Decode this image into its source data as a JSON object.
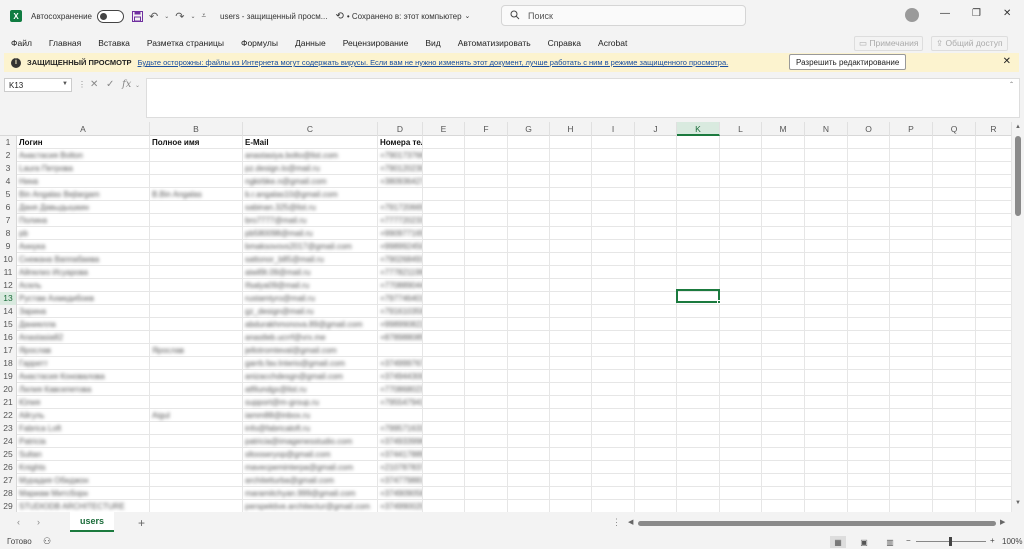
{
  "app": {
    "autosave_label": "Автосохранение",
    "doc_title": "users  -  защищенный просм...",
    "saved_status": "• Сохранено в: этот компьютер",
    "search_placeholder": "Поиск"
  },
  "ribbon": {
    "tabs": [
      "Файл",
      "Главная",
      "Вставка",
      "Разметка страницы",
      "Формулы",
      "Данные",
      "Рецензирование",
      "Вид",
      "Автоматизировать",
      "Справка",
      "Acrobat"
    ],
    "comments": "Примечания",
    "share": "Общий доступ"
  },
  "protected_view": {
    "title": "ЗАЩИЩЕННЫЙ ПРОСМОТР",
    "message": "Будьте осторожны: файлы из Интернета могут содержать вирусы. Если вам не нужно изменять этот документ, лучше работать с ним в режиме защищенного просмотра.",
    "enable_button": "Разрешить редактирование"
  },
  "formula_bar": {
    "name_box": "K13",
    "formula": ""
  },
  "grid": {
    "columns": [
      "A",
      "B",
      "C",
      "D",
      "E",
      "F",
      "G",
      "H",
      "I",
      "J",
      "K",
      "L",
      "M",
      "N",
      "O",
      "P",
      "Q",
      "R"
    ],
    "active_column": "K",
    "active_row": "13",
    "header_row": {
      "row": "1",
      "a": "Логин",
      "b": "Полное имя",
      "c": "E-Mail",
      "d": "Номера телефонов"
    },
    "rows": [
      {
        "num": "2",
        "a": "Анастасия Bolton",
        "b": "",
        "c": "anastasiya.bolto@list.com",
        "d": "+79017376655"
      },
      {
        "num": "3",
        "a": "Laura Петрова",
        "b": "",
        "c": "pz.design.lo@mail.ru",
        "d": "+79012023039"
      },
      {
        "num": "4",
        "a": "Нина",
        "b": "",
        "c": "ngkirbke.n@gmail.com",
        "d": "+380936427473"
      },
      {
        "num": "5",
        "a": "Bin Angalas Bejlargam",
        "b": "B.Bin Angalas",
        "c": "b.r.angalas10@gmail.com",
        "d": ""
      },
      {
        "num": "6",
        "a": "Даня Давыдышкин",
        "b": "",
        "c": "sabinan.325@list.ru",
        "d": "+79172066518"
      },
      {
        "num": "7",
        "a": "Полина",
        "b": "",
        "c": "bro7777@mail.ru",
        "d": "+77772023396"
      },
      {
        "num": "8",
        "a": "pb",
        "b": "",
        "c": "pb580098@mail.ru",
        "d": "+990977165008"
      },
      {
        "num": "9",
        "a": "Аннука",
        "b": "",
        "c": "bmaksovovs2017@gmail.com",
        "d": "+998992450145"
      },
      {
        "num": "10",
        "a": "Снежана Ваппабаева",
        "b": "",
        "c": "sattonor_b85@mail.ru",
        "d": "+79026849190"
      },
      {
        "num": "11",
        "a": "Айпелиз Исуарова",
        "b": "",
        "c": "aiwil9t.09@mail.ru",
        "d": "+77782119960"
      },
      {
        "num": "12",
        "a": "Асель",
        "b": "",
        "c": "Ifsalya09@mail.ru",
        "d": "+77088904402"
      },
      {
        "num": "13",
        "a": "Рустам Ахмедибоев",
        "b": "",
        "c": "rustamtyro@mail.ru",
        "d": "+79774640119"
      },
      {
        "num": "14",
        "a": "Зарина",
        "b": "",
        "c": "gz_design@mail.ru",
        "d": "+79161035964"
      },
      {
        "num": "15",
        "a": "Даниелла",
        "b": "",
        "c": "abdurakhmonova.89@gmail.com",
        "d": "+998990822299"
      },
      {
        "num": "16",
        "a": "Anastasia82",
        "b": "",
        "c": "anastleb.ucrrf@vrx.me",
        "d": "+87898808500"
      },
      {
        "num": "17",
        "a": "Ярослав",
        "b": "Ярослав",
        "c": "jellotromteval@gmail.com",
        "d": ""
      },
      {
        "num": "18",
        "a": "Гарретт",
        "b": "",
        "c": "garrb.fav.Interio@gmail.com",
        "d": "+37499976777"
      },
      {
        "num": "19",
        "a": "Анастасия Коновалова",
        "b": "",
        "c": "anizacchdesgn@gmail.com",
        "d": "+37494430081"
      },
      {
        "num": "20",
        "a": "Лилия Кавсепетова",
        "b": "",
        "c": "atfilundgx@list.ru",
        "d": "+77086802393"
      },
      {
        "num": "21",
        "a": "Юлия",
        "b": "",
        "c": "support@m-group.ru",
        "d": "+79554794177"
      },
      {
        "num": "22",
        "a": "Айгуль",
        "b": "Aigul",
        "c": "iamm88@inbox.ru",
        "d": ""
      },
      {
        "num": "23",
        "a": "Fabrica Loft",
        "b": "",
        "c": "info@fabricaloft.ru",
        "d": "+79957163377"
      },
      {
        "num": "24",
        "a": "Patricia",
        "b": "",
        "c": "patricia@imagenesstudio.com",
        "d": "+37493399698"
      },
      {
        "num": "25",
        "a": "Sultan",
        "b": "",
        "c": "sltooseryop@gmail.com",
        "d": "+37441788979"
      },
      {
        "num": "26",
        "a": "Knights",
        "b": "",
        "c": "mavecpeminterpa@gmail.com",
        "d": "+21078783796"
      },
      {
        "num": "27",
        "a": "Мурадия Обиджон",
        "b": "",
        "c": "architetturba@gmail.com",
        "d": "+37477988177"
      },
      {
        "num": "28",
        "a": "Мариам Митсборн",
        "b": "",
        "c": "maramitchyan.999@gmail.com",
        "d": "+37490905819"
      },
      {
        "num": "29",
        "a": "STUDIODB ARCHITECTURE",
        "b": "",
        "c": "perspektive.architectur@gmail.com",
        "d": "+37499002002"
      }
    ]
  },
  "sheets": {
    "active": "users"
  },
  "status": {
    "ready": "Готово",
    "zoom": "100%"
  }
}
